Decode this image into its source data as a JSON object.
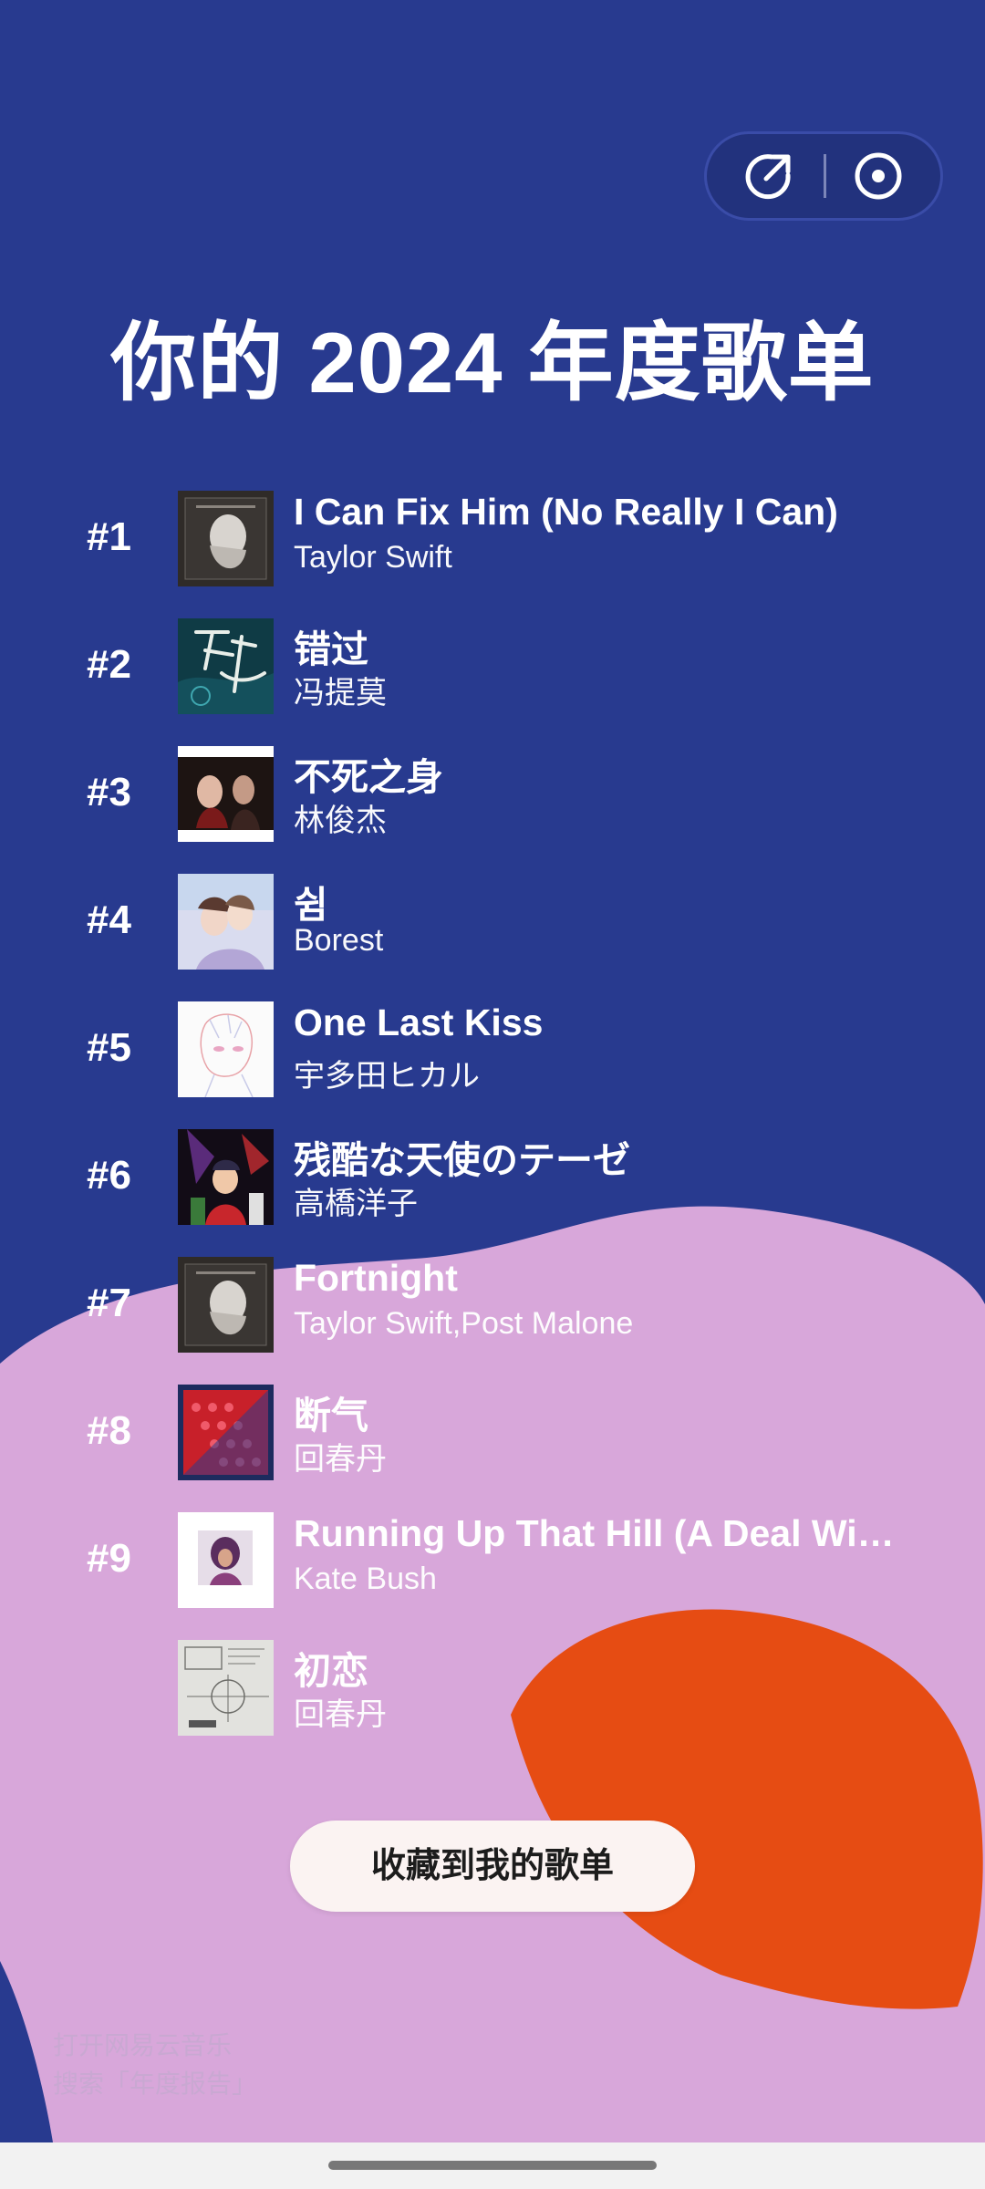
{
  "title": "你的 2024 年度歌单",
  "colors": {
    "background": "#283a8f",
    "blob_pink": "#d8a7da",
    "blob_orange": "#e64c13",
    "button_bg": "#fbf3f2"
  },
  "top_actions": {
    "share_icon": "share-arrow-icon",
    "record_icon": "record-disc-icon"
  },
  "songs": [
    {
      "rank": "#1",
      "title": "I Can Fix Him (No Really I Can)",
      "artist": "Taylor Swift"
    },
    {
      "rank": "#2",
      "title": "错过",
      "artist": "冯提莫"
    },
    {
      "rank": "#3",
      "title": "不死之身",
      "artist": "林俊杰"
    },
    {
      "rank": "#4",
      "title": "쉼",
      "artist": "Borest"
    },
    {
      "rank": "#5",
      "title": "One Last Kiss",
      "artist": "宇多田ヒカル"
    },
    {
      "rank": "#6",
      "title": "残酷な天使のテーゼ",
      "artist": "高橋洋子"
    },
    {
      "rank": "#7",
      "title": "Fortnight",
      "artist": "Taylor Swift,Post Malone"
    },
    {
      "rank": "#8",
      "title": "断气",
      "artist": "回春丹"
    },
    {
      "rank": "#9",
      "title": "Running Up That Hill (A Deal With God)",
      "artist": "Kate Bush"
    },
    {
      "rank": "",
      "title": "初恋",
      "artist": "回春丹"
    }
  ],
  "save_button": "收藏到我的歌单",
  "hint": {
    "line1": "打开网易云音乐",
    "line2": "搜索「年度报告」"
  }
}
